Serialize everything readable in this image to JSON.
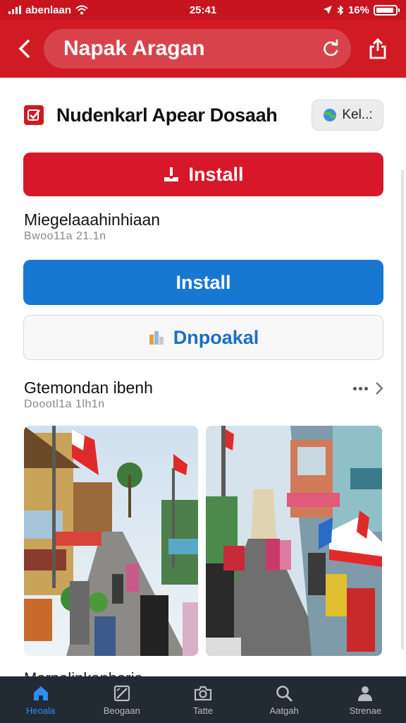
{
  "status_bar": {
    "carrier": "abenlaan",
    "time": "25:41",
    "battery": "16%"
  },
  "nav": {
    "title": "Napak Aragan"
  },
  "app": {
    "name": "Nudenkarl Apear Dosaah",
    "chip_label": "Kel..:"
  },
  "buttons": {
    "install_primary": "Install",
    "install_secondary": "Install",
    "update": "Dnpoakal"
  },
  "section1": {
    "title": "Miegelaaahinhiaan",
    "subtitle": "Bwoo11a 21.1n"
  },
  "section2": {
    "title": "Gtemondan ibenh",
    "subtitle": "Doootl1a 1lh1n"
  },
  "section3": {
    "title": "Marnalinkanbaria"
  },
  "tabs": [
    {
      "label": "Heoala",
      "icon": "home-icon",
      "active": true
    },
    {
      "label": "Beogaan",
      "icon": "image-edit-icon",
      "active": false
    },
    {
      "label": "Tatte",
      "icon": "camera-icon",
      "active": false
    },
    {
      "label": "Aatgah",
      "icon": "search-icon",
      "active": false
    },
    {
      "label": "Strenae",
      "icon": "profile-icon",
      "active": false
    }
  ],
  "colors": {
    "brand_red": "#d01a24",
    "install_red": "#d7182a",
    "install_blue": "#1778d2",
    "tab_active": "#2f8ef0",
    "tab_bar": "#222a34"
  }
}
